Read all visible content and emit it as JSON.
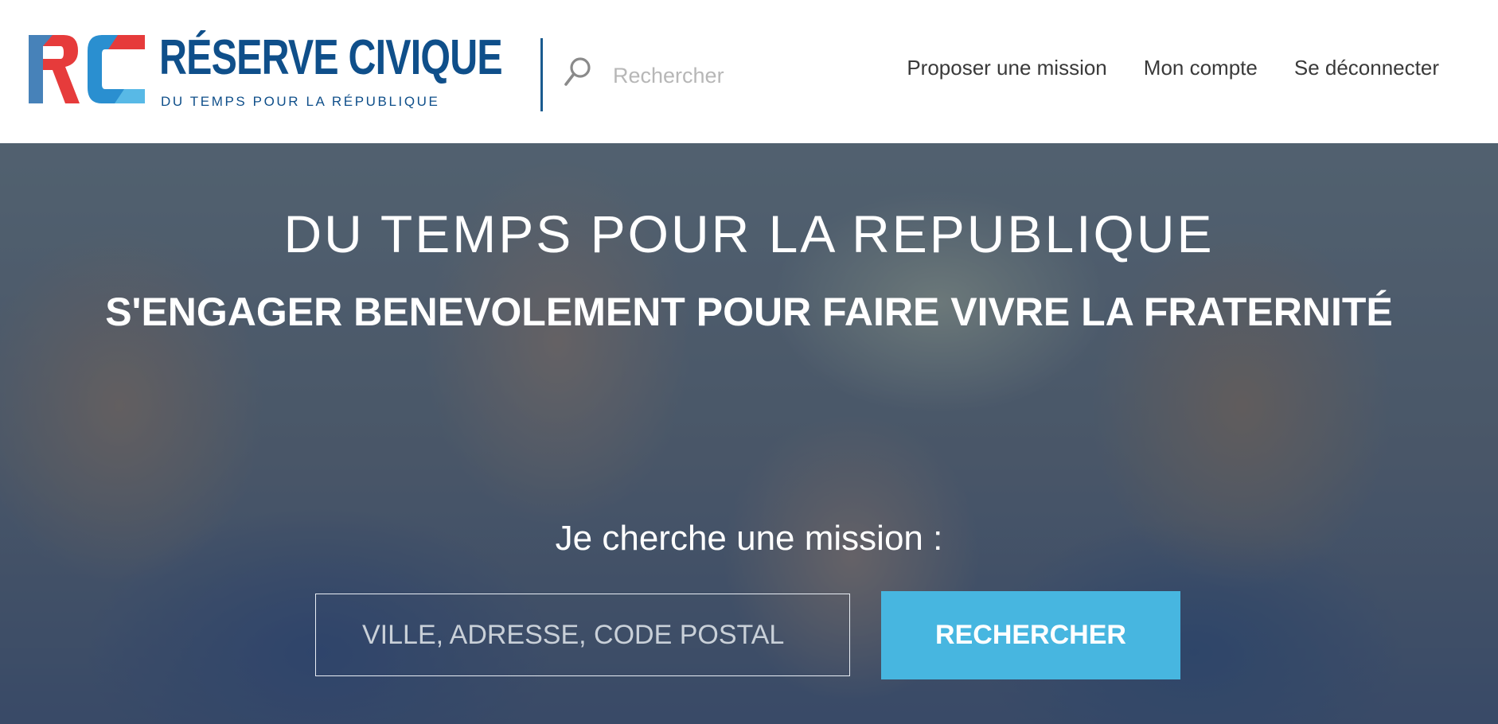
{
  "brand": {
    "title": "RÉSERVE CIVIQUE",
    "tagline": "DU TEMPS POUR LA RÉPUBLIQUE",
    "logo_letters": "RC",
    "colors": {
      "red": "#e63b3b",
      "blue": "#2a8fd0",
      "navy": "#0f4f8a"
    }
  },
  "header": {
    "search_placeholder": "Rechercher",
    "search_icon": "search-icon",
    "nav": [
      {
        "label": "Proposer une mission"
      },
      {
        "label": "Mon compte"
      },
      {
        "label": "Se déconnecter"
      }
    ]
  },
  "hero": {
    "title": "DU TEMPS POUR LA REPUBLIQUE",
    "subtitle": "S'ENGAGER BENEVOLEMENT POUR FAIRE VIVRE LA FRATERNITÉ",
    "mission_label": "Je cherche une mission :",
    "address_placeholder": "VILLE, ADRESSE, CODE POSTAL",
    "search_button": "RECHERCHER",
    "button_color": "#47b6e0"
  }
}
